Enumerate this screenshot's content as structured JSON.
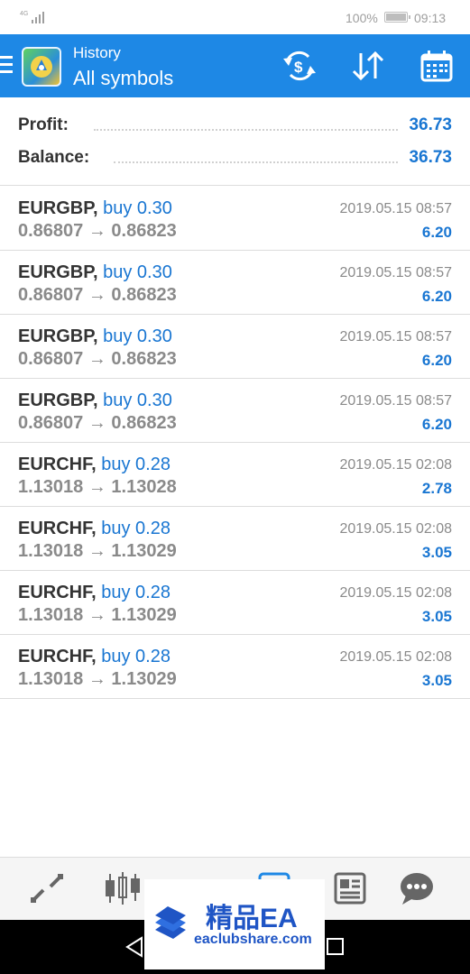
{
  "status": {
    "network": "4G",
    "battery": "100%",
    "time": "09:13"
  },
  "header": {
    "subtitle": "History",
    "title": "All symbols",
    "tools": [
      "currency-exchange-icon",
      "sort-icon",
      "calendar-icon"
    ]
  },
  "summary": {
    "profit_label": "Profit:",
    "profit_value": "36.73",
    "balance_label": "Balance:",
    "balance_value": "36.73"
  },
  "deals": [
    {
      "symbol": "EURGBP,",
      "type": "buy 0.30",
      "prices": "0.86807 → 0.86823",
      "time": "2019.05.15 08:57",
      "profit": "6.20"
    },
    {
      "symbol": "EURGBP,",
      "type": "buy 0.30",
      "prices": "0.86807 → 0.86823",
      "time": "2019.05.15 08:57",
      "profit": "6.20"
    },
    {
      "symbol": "EURGBP,",
      "type": "buy 0.30",
      "prices": "0.86807 → 0.86823",
      "time": "2019.05.15 08:57",
      "profit": "6.20"
    },
    {
      "symbol": "EURGBP,",
      "type": "buy 0.30",
      "prices": "0.86807 → 0.86823",
      "time": "2019.05.15 08:57",
      "profit": "6.20"
    },
    {
      "symbol": "EURCHF,",
      "type": "buy 0.28",
      "prices": "1.13018 → 1.13028",
      "time": "2019.05.15 02:08",
      "profit": "2.78"
    },
    {
      "symbol": "EURCHF,",
      "type": "buy 0.28",
      "prices": "1.13018 → 1.13029",
      "time": "2019.05.15 02:08",
      "profit": "3.05"
    },
    {
      "symbol": "EURCHF,",
      "type": "buy 0.28",
      "prices": "1.13018 → 1.13029",
      "time": "2019.05.15 02:08",
      "profit": "3.05"
    },
    {
      "symbol": "EURCHF,",
      "type": "buy 0.28",
      "prices": "1.13018 → 1.13029",
      "time": "2019.05.15 02:08",
      "profit": "3.05"
    }
  ],
  "bottom_nav": [
    "quotes-icon",
    "chart-icon",
    "trade-icon",
    "history-icon",
    "news-icon",
    "chat-icon"
  ],
  "watermark": {
    "title": "精品EA",
    "url": "eaclubshare.com"
  },
  "colors": {
    "accent": "#1e88e5",
    "value_blue": "#1976d2"
  }
}
